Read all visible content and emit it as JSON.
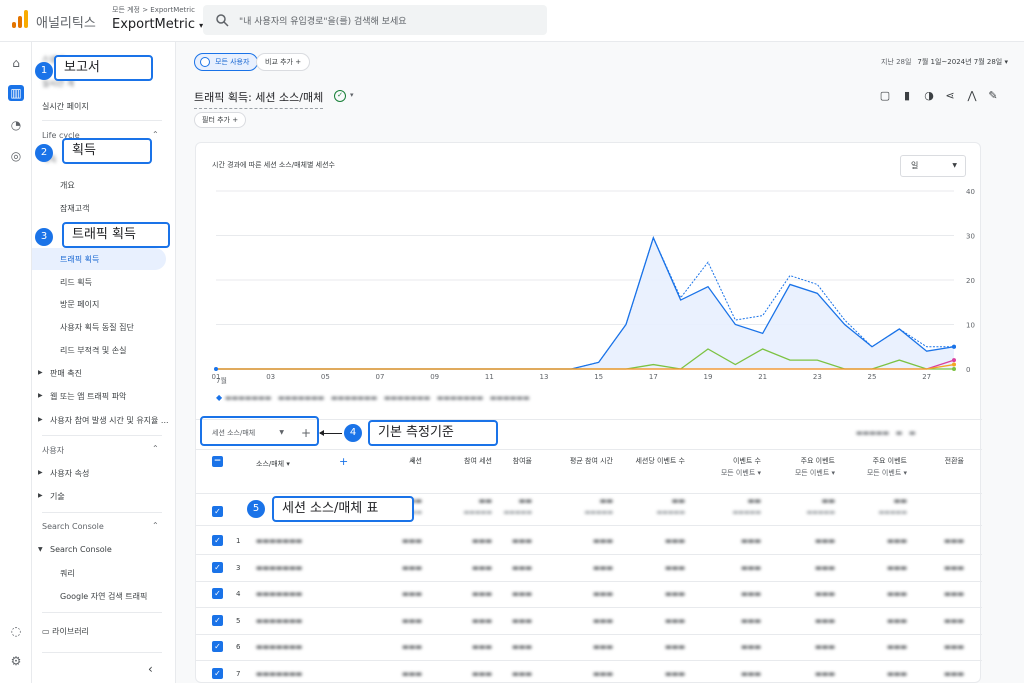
{
  "topbar": {
    "app_name": "애널리틱스",
    "account_crumb": "모든 계정 > ExportMetric",
    "property_name": "ExportMetric",
    "search_placeholder": "\"내 사용자의 유입경로\"을(를) 검색해 보세요"
  },
  "colors": {
    "accent": "#1a73e8",
    "logo": [
      "#f9ab00",
      "#e37400",
      "#e37400"
    ],
    "series_main": "#1a73e8",
    "series_green": "#7cc242",
    "series_orange": "#f5a623",
    "series_pink": "#d93fa0"
  },
  "sidebar": {
    "items": {
      "snapshot_partial": "스냅샷",
      "realtime_overview_partial": "실시간 개",
      "realtime_pages": "실시간 페이지",
      "lifecycle": "Life cycle",
      "acquisition_partial": "획득",
      "overview": "개요",
      "potential_customers": "잠재고객",
      "traffic_acquisition": "트래픽 획득",
      "lead_acquisition": "리드 획득",
      "landing_page": "방문 페이지",
      "user_acq_cohort": "사용자 획득 동질 집단",
      "lead_tracking": "리드 부적격 및 손실",
      "sales_promotion": "판매 촉진",
      "web_app_traffic": "웹 또는 앱 트래픽 파악",
      "user_engagement": "사용자 참여 발생 시간 및 유지율 ...",
      "user_section": "사용자",
      "user_attributes": "사용자 속성",
      "tech": "기술",
      "search_console_section": "Search Console",
      "search_console": "Search Console",
      "queries": "쿼리",
      "google_organic": "Google 자연 검색 트래픽",
      "library": "라이브러리"
    }
  },
  "header": {
    "chip_all_users": "모든 사용자",
    "chip_compare": "비교 추가",
    "date_label": "지난 28일",
    "date_range": "7월 1일~2024년 7월 28일",
    "page_title": "트래픽 획득: 세션 소스/매체",
    "filter_add": "필터 추가"
  },
  "chart_data": {
    "type": "line",
    "title": "시간 경과에 따른 세션 소스/매체별 세션수",
    "period_select": "일",
    "x_tick_labels": [
      "01",
      "03",
      "05",
      "07",
      "09",
      "11",
      "13",
      "15",
      "17",
      "19",
      "21",
      "23",
      "25",
      "27"
    ],
    "x_month_label": "7월",
    "ylim": [
      0,
      40
    ],
    "y_ticks": [
      0,
      10,
      20,
      30,
      40
    ],
    "x": [
      1,
      2,
      3,
      4,
      5,
      6,
      7,
      8,
      9,
      10,
      11,
      12,
      13,
      14,
      15,
      16,
      17,
      18,
      19,
      20,
      21,
      22,
      23,
      24,
      25,
      26,
      27,
      28
    ],
    "series": [
      {
        "values": [
          0,
          0,
          0,
          0,
          0,
          0,
          0,
          0,
          0,
          0,
          0,
          0,
          0,
          0,
          1.5,
          10,
          29.5,
          15.5,
          18.5,
          10,
          8,
          19,
          17,
          10,
          5,
          9,
          4,
          5
        ],
        "color": "#1a73e8",
        "fill": true
      },
      {
        "values": [
          0,
          0,
          0,
          0,
          0,
          0,
          0,
          0,
          0,
          0,
          0,
          0,
          0,
          0,
          1.5,
          10,
          29.5,
          16,
          24,
          11,
          12,
          21,
          19,
          11,
          5,
          9,
          5,
          5
        ],
        "color": "#1a73e8",
        "dashed": true
      },
      {
        "values": [
          0,
          0,
          0,
          0,
          0,
          0,
          0,
          0,
          0,
          0,
          0,
          0,
          0,
          0,
          0,
          0,
          1,
          0,
          4.5,
          1,
          4.5,
          2,
          2,
          0,
          0,
          2,
          0,
          0
        ],
        "color": "#7cc242"
      },
      {
        "values": [
          0,
          0,
          0,
          0,
          0,
          0,
          0,
          0,
          0,
          0,
          0,
          0,
          0,
          0,
          0,
          0,
          0,
          0,
          0,
          0,
          0,
          0,
          0,
          0,
          0,
          0,
          0,
          2
        ],
        "color": "#d93fa0"
      },
      {
        "values": [
          0,
          0,
          0,
          0,
          0,
          0,
          0,
          0,
          0,
          0,
          0,
          0,
          0,
          0,
          0,
          0,
          0,
          0,
          0,
          0,
          0,
          0,
          0,
          0,
          0,
          0,
          0,
          1
        ],
        "color": "#f5a623"
      }
    ]
  },
  "table": {
    "dimension_select": "세션 소스/매체",
    "dim_column_header": "소스/매체",
    "columns": [
      "세션",
      "참여 세션",
      "참여율",
      "평균 참여 시간",
      "세션당 이벤트 수",
      "이벤트 수",
      "주요 이벤트",
      "주요 이벤트",
      "전환율"
    ],
    "sort_arrow": "↓",
    "column_subs": [
      "모든 이벤트",
      "모든 이벤트",
      "모든 이벤트"
    ],
    "row_numbers": [
      "1",
      "3",
      "4",
      "5",
      "6",
      "7"
    ]
  },
  "annotations": {
    "a1": {
      "num": "1",
      "label": "보고서"
    },
    "a2": {
      "num": "2",
      "label": "획득"
    },
    "a3": {
      "num": "3",
      "label": "트래픽 획득"
    },
    "a4": {
      "num": "4",
      "label": "기본 측정기준"
    },
    "a5": {
      "num": "5",
      "label": "세션 소스/매체 표"
    }
  }
}
